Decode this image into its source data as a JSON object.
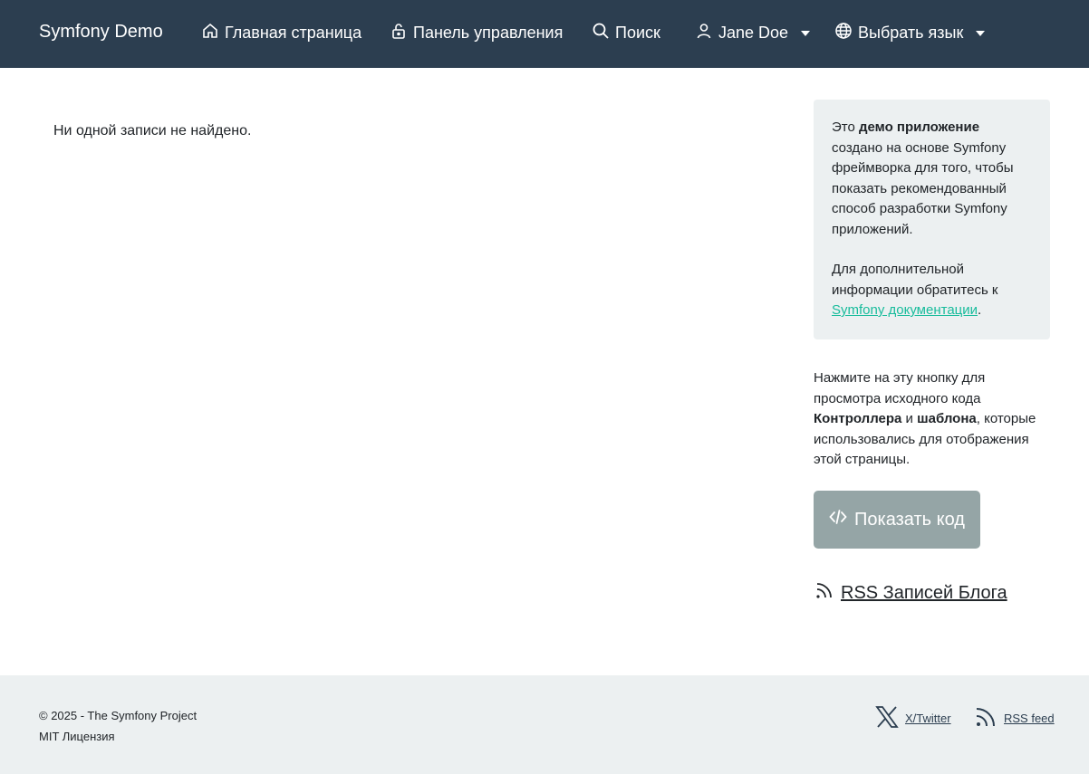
{
  "navbar": {
    "brand": "Symfony Demo",
    "items": [
      {
        "label": "Главная страница",
        "icon": "home-icon"
      },
      {
        "label": "Панель управления",
        "icon": "lock-icon"
      },
      {
        "label": "Поиск",
        "icon": "search-icon"
      },
      {
        "label": "Jane Doe",
        "icon": "user-icon",
        "dropdown": true
      },
      {
        "label": "Выбрать язык",
        "icon": "globe-icon",
        "dropdown": true
      }
    ]
  },
  "main": {
    "empty_message": "Ни одной записи не найдено."
  },
  "sidebar": {
    "info": {
      "p1_prefix": "Это ",
      "p1_bold": "демо приложение",
      "p1_suffix": " создано на основе Symfony фреймворка для того, чтобы показать рекомендованный способ разработки Symfony приложений.",
      "p2_prefix": "Для дополнительной информации обратитесь к ",
      "p2_link": "Symfony документации",
      "p2_suffix": "."
    },
    "hint": {
      "prefix": "Нажмите на эту кнопку для просмотра исходного кода ",
      "bold1": "Контроллера",
      "mid": " и ",
      "bold2": "шаблона",
      "suffix": ", которые использовались для отображения этой страницы."
    },
    "show_code_label": "Показать код",
    "rss_label": "RSS Записей Блога"
  },
  "footer": {
    "copyright": "© 2025 - The Symfony Project",
    "license": "MIT Лицензия",
    "twitter_label": "X/Twitter",
    "rss_label": "RSS feed"
  },
  "colors": {
    "navbar_bg": "#2c3e50",
    "panel_bg": "#ecf0f1",
    "button_bg": "#95a5a6",
    "link": "#18bc9c"
  }
}
